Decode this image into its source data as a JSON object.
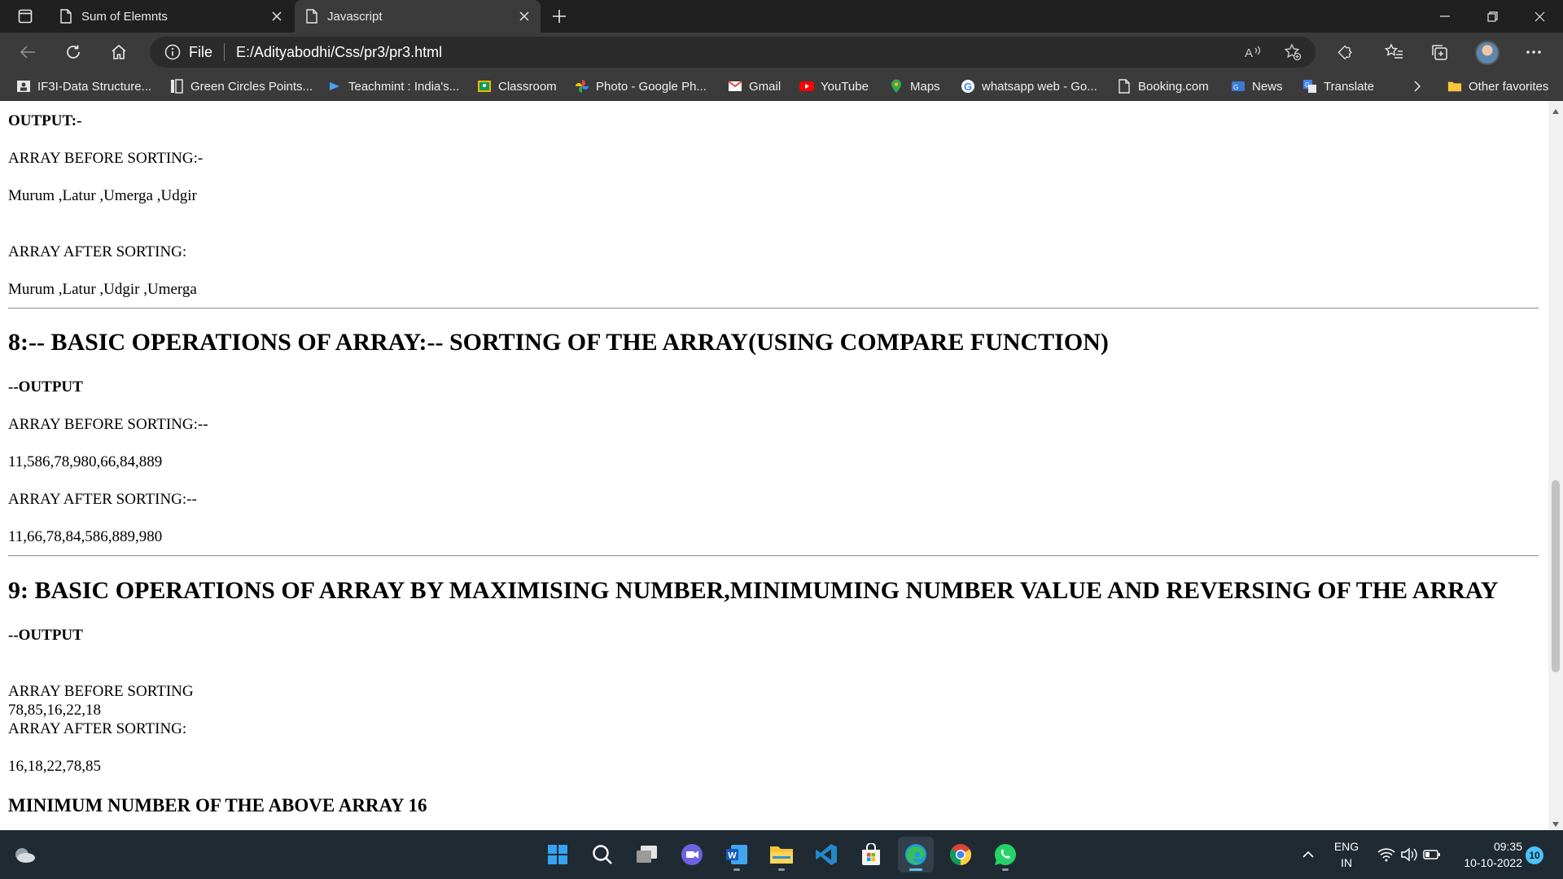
{
  "browser": {
    "tabs": [
      {
        "title": "Sum of Elemnts",
        "active": false
      },
      {
        "title": "Javascript",
        "active": true
      }
    ],
    "address": {
      "scheme_label": "File",
      "url": "E:/Adityabodhi/Css/pr3/pr3.html"
    },
    "favorites": [
      {
        "label": "IF3I-Data Structure...",
        "icon": "classroom-icon"
      },
      {
        "label": "Green Circles Points...",
        "icon": "bookmark-icon"
      },
      {
        "label": "Teachmint : India's...",
        "icon": "teachmint-icon"
      },
      {
        "label": "Classroom",
        "icon": "classroom-icon"
      },
      {
        "label": "Photo - Google Ph...",
        "icon": "photos-icon"
      },
      {
        "label": "Gmail",
        "icon": "gmail-icon"
      },
      {
        "label": "YouTube",
        "icon": "youtube-icon"
      },
      {
        "label": "Maps",
        "icon": "maps-icon"
      },
      {
        "label": "whatsapp web - Go...",
        "icon": "google-icon"
      },
      {
        "label": "Booking.com",
        "icon": "page-icon"
      },
      {
        "label": "News",
        "icon": "news-icon"
      },
      {
        "label": "Translate",
        "icon": "translate-icon"
      }
    ],
    "other_favorites": "Other favorites"
  },
  "content": {
    "output_label": "OUTPUT:-",
    "s7_before_label": "ARRAY BEFORE SORTING:-",
    "s7_before_values": "Murum ,Latur ,Umerga ,Udgir",
    "s7_after_label": "ARRAY AFTER SORTING:",
    "s7_after_values": "Murum ,Latur ,Udgir ,Umerga",
    "s8_heading": "8:-- BASIC OPERATIONS OF ARRAY:-- SORTING OF THE ARRAY(USING COMPARE FUNCTION)",
    "s8_output_label": "--OUTPUT",
    "s8_before_label": "ARRAY BEFORE SORTING:--",
    "s8_before_values": "11,586,78,980,66,84,889",
    "s8_after_label": "ARRAY AFTER SORTING:--",
    "s8_after_values": "11,66,78,84,586,889,980",
    "s9_heading": "9: BASIC OPERATIONS OF ARRAY BY MAXIMISING NUMBER,MINIMUMING NUMBER VALUE AND REVERSING OF THE ARRAY",
    "s9_output_label": "--OUTPUT",
    "s9_before_label": "ARRAY BEFORE SORTING",
    "s9_before_values": "78,85,16,22,18",
    "s9_after_label": "ARRAY AFTER SORTING:",
    "s9_after_values": "16,18,22,78,85",
    "s9_min_line": "MINIMUM NUMBER OF THE ABOVE ARRAY 16"
  },
  "taskbar": {
    "apps": [
      "start-icon",
      "search-icon",
      "task-view-icon",
      "chat-icon",
      "word-icon",
      "file-explorer-icon",
      "vscode-icon",
      "store-icon",
      "edge-icon",
      "chrome-icon",
      "whatsapp-icon"
    ],
    "language_line1": "ENG",
    "language_line2": "IN",
    "time": "09:35",
    "date": "10-10-2022",
    "notifications": "10"
  },
  "colors": {
    "titlebar": "#202020",
    "toolbar": "#3b3b3b",
    "omnibox": "#2b2b2b",
    "taskbar": "#202a33",
    "accent": "#4cc2ff"
  }
}
